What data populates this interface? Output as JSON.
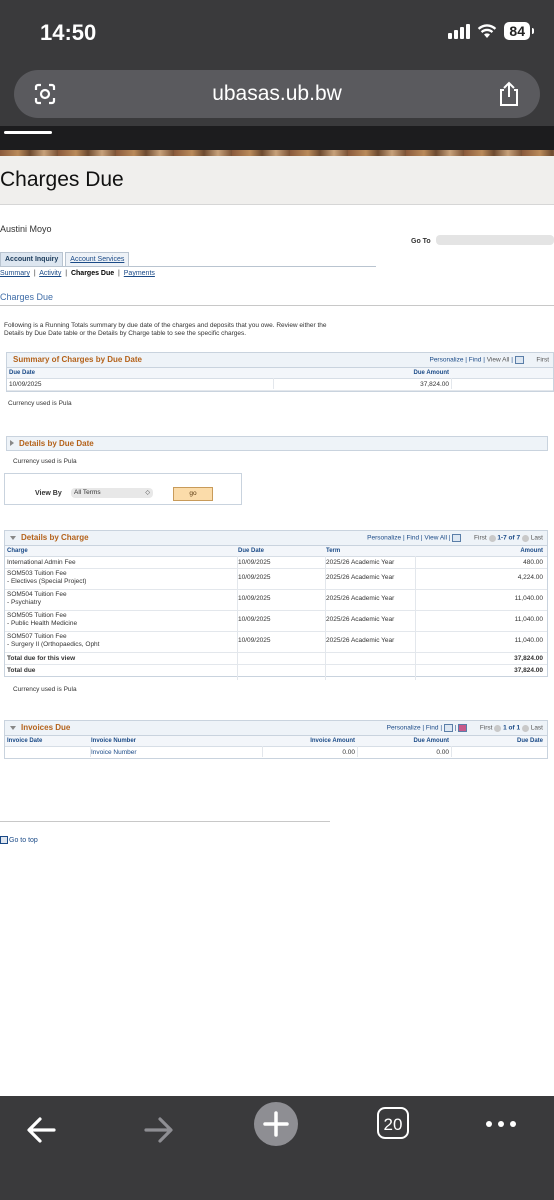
{
  "status_bar": {
    "time": "14:50",
    "battery": "84"
  },
  "browser": {
    "url": "ubasas.ub.bw",
    "tab_count": "20"
  },
  "page": {
    "title": "Charges Due"
  },
  "student": {
    "name": "Austini Moyo"
  },
  "goto": {
    "label": "Go To"
  },
  "tabs": {
    "account_inquiry": "Account Inquiry",
    "account_services": "Account Services"
  },
  "subnav": {
    "summary": "Summary",
    "sep": "|",
    "activity": "Activity",
    "charges_due": "Charges Due",
    "payments": "Payments"
  },
  "section": {
    "title": "Charges Due",
    "intro": "Following is a Running Totals summary by due date of the charges and deposits that you owe. Review either the Details by Due Date table or the Details by Charge table to see the specific charges."
  },
  "summary_grid": {
    "title": "Summary of Charges by Due Date",
    "tools": {
      "personalize": "Personalize",
      "find": "Find",
      "view_all": "View All",
      "first": "First"
    },
    "columns": {
      "due_date": "Due Date",
      "due_amount": "Due Amount"
    },
    "rows": [
      {
        "due_date": "10/09/2025",
        "due_amount": "37,824.00"
      }
    ],
    "currency": "Currency used is Pula"
  },
  "details_by_due_date": {
    "title": "Details by Due Date",
    "currency": "Currency used is Pula"
  },
  "view_by": {
    "label": "View By",
    "selected": "All Terms",
    "go": "go"
  },
  "charge_grid": {
    "title": "Details by Charge",
    "tools": {
      "personalize": "Personalize",
      "find": "Find",
      "view_all": "View All",
      "first": "First",
      "range": "1-7 of 7",
      "last": "Last"
    },
    "columns": {
      "charge": "Charge",
      "due_date": "Due Date",
      "term": "Term",
      "amount": "Amount"
    },
    "rows": [
      {
        "line1": "International Admin Fee",
        "line2": "",
        "due_date": "10/09/2025",
        "term": "2025/26 Academic Year",
        "amount": "480.00"
      },
      {
        "line1": "SOM503 Tuition Fee",
        "line2": "- Electives (Special Project)",
        "due_date": "10/09/2025",
        "term": "2025/26 Academic Year",
        "amount": "4,224.00"
      },
      {
        "line1": "SOM504 Tuition Fee",
        "line2": "- Psychiatry",
        "due_date": "10/09/2025",
        "term": "2025/26 Academic Year",
        "amount": "11,040.00"
      },
      {
        "line1": "SOM505 Tuition Fee",
        "line2": "- Public Health Medicine",
        "due_date": "10/09/2025",
        "term": "2025/26 Academic Year",
        "amount": "11,040.00"
      },
      {
        "line1": "SOM507 Tuition Fee",
        "line2": "- Surgery II (Orthopaedics, Opht",
        "due_date": "10/09/2025",
        "term": "2025/26 Academic Year",
        "amount": "11,040.00"
      }
    ],
    "total_view": {
      "label": "Total due for this view",
      "amount": "37,824.00"
    },
    "total_due": {
      "label": "Total due",
      "amount": "37,824.00"
    },
    "currency": "Currency used is Pula"
  },
  "invoices_grid": {
    "title": "Invoices Due",
    "tools": {
      "personalize": "Personalize",
      "find": "Find",
      "first": "First",
      "range": "1 of 1",
      "last": "Last"
    },
    "columns": {
      "invoice_date": "Invoice Date",
      "invoice_number": "Invoice Number",
      "invoice_amount": "Invoice Amount",
      "due_amount": "Due Amount",
      "due_date": "Due Date"
    },
    "rows": [
      {
        "invoice_date": "",
        "invoice_number": "Invoice Number",
        "invoice_amount": "0.00",
        "due_amount": "0.00",
        "due_date": ""
      }
    ]
  },
  "footer": {
    "go_to_top": "Go to top"
  }
}
